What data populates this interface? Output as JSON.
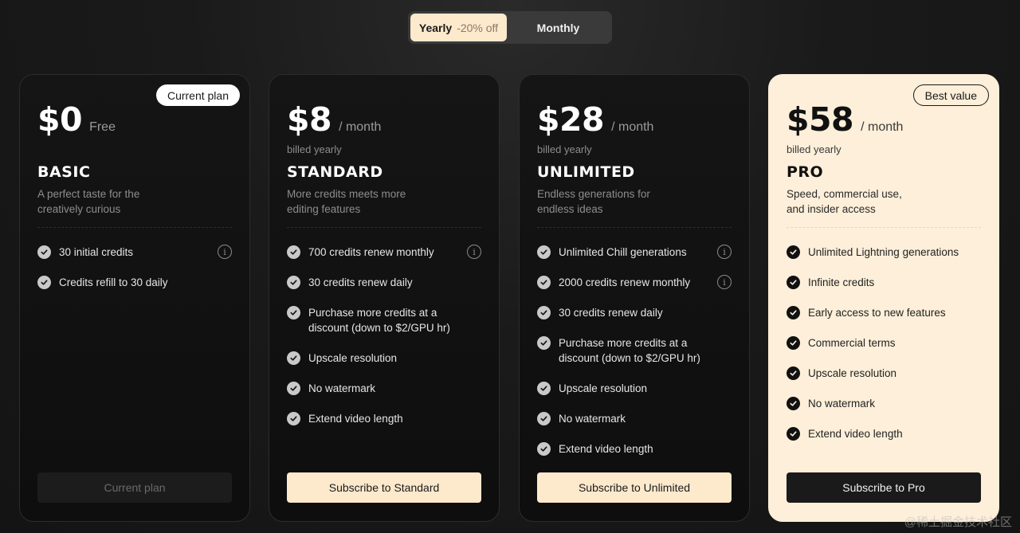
{
  "billing_toggle": {
    "yearly_label": "Yearly",
    "yearly_discount": "-20% off",
    "monthly_label": "Monthly",
    "selected": "Yearly"
  },
  "plans": [
    {
      "badge": "Current plan",
      "price": "$0",
      "period": "Free",
      "billed": "",
      "name": "BASIC",
      "description": "A perfect taste for the creatively curious",
      "features": [
        {
          "text": "30 initial credits",
          "info": true
        },
        {
          "text": "Credits refill to 30 daily",
          "info": false
        }
      ],
      "cta": "Current plan"
    },
    {
      "badge": "",
      "price": "$8",
      "period": "/ month",
      "billed": "billed yearly",
      "name": "STANDARD",
      "description": "More credits meets more editing features",
      "features": [
        {
          "text": "700 credits renew monthly",
          "info": true
        },
        {
          "text": "30 credits renew daily",
          "info": false
        },
        {
          "text": "Purchase more credits at a discount (down to $2/GPU hr)",
          "info": false
        },
        {
          "text": "Upscale resolution",
          "info": false
        },
        {
          "text": "No watermark",
          "info": false
        },
        {
          "text": "Extend video length",
          "info": false
        }
      ],
      "cta": "Subscribe to Standard"
    },
    {
      "badge": "",
      "price": "$28",
      "period": "/ month",
      "billed": "billed yearly",
      "name": "UNLIMITED",
      "description": "Endless generations for endless ideas",
      "features": [
        {
          "text": "Unlimited Chill generations",
          "info": true
        },
        {
          "text": "2000 credits renew monthly",
          "info": true
        },
        {
          "text": "30 credits renew daily",
          "info": false
        },
        {
          "text": "Purchase more credits at a discount (down to $2/GPU hr)",
          "info": false
        },
        {
          "text": "Upscale resolution",
          "info": false
        },
        {
          "text": "No watermark",
          "info": false
        },
        {
          "text": "Extend video length",
          "info": false
        }
      ],
      "cta": "Subscribe to Unlimited"
    },
    {
      "badge": "Best value",
      "price": "$58",
      "period": "/ month",
      "billed": "billed yearly",
      "name": "PRO",
      "description": "Speed, commercial use, and insider access",
      "features": [
        {
          "text": "Unlimited Lightning generations",
          "info": false
        },
        {
          "text": "Infinite credits",
          "info": false
        },
        {
          "text": "Early access to new features",
          "info": false
        },
        {
          "text": "Commercial terms",
          "info": false
        },
        {
          "text": "Upscale resolution",
          "info": false
        },
        {
          "text": "No watermark",
          "info": false
        },
        {
          "text": "Extend video length",
          "info": false
        }
      ],
      "cta": "Subscribe to Pro"
    }
  ],
  "watermark": "@稀土掘金技术社区",
  "icons": {
    "check": "check-circle-icon",
    "info": "info-icon"
  },
  "colors": {
    "accent_cream": "#fde9cc",
    "pro_card_bg": "#fdefd9"
  }
}
